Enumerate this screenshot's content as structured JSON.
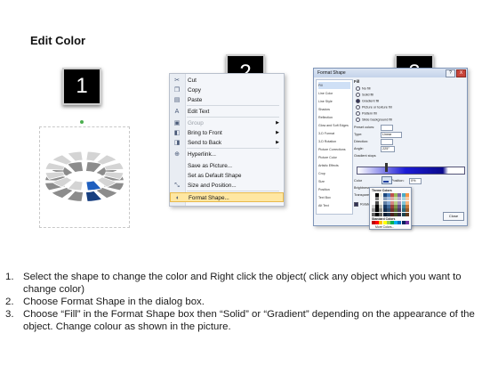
{
  "title": "Edit Color",
  "badges": [
    "1",
    "2",
    "3"
  ],
  "context_menu": {
    "items": [
      {
        "label": "Cut",
        "icon": "scissors-icon",
        "glyph": "✂",
        "disabled": false,
        "arrow": false
      },
      {
        "label": "Copy",
        "icon": "copy-icon",
        "glyph": "❐",
        "disabled": false,
        "arrow": false
      },
      {
        "label": "Paste",
        "icon": "paste-icon",
        "glyph": "▤",
        "disabled": false,
        "arrow": false
      },
      {
        "label": "Edit Text",
        "icon": "edit-text-icon",
        "glyph": "A",
        "disabled": false,
        "arrow": false
      },
      {
        "label": "Group",
        "icon": "group-icon",
        "glyph": "▣",
        "disabled": true,
        "arrow": true
      },
      {
        "label": "Bring to Front",
        "icon": "bring-front-icon",
        "glyph": "◧",
        "disabled": false,
        "arrow": true
      },
      {
        "label": "Send to Back",
        "icon": "send-back-icon",
        "glyph": "◨",
        "disabled": false,
        "arrow": true
      },
      {
        "label": "Hyperlink...",
        "icon": "hyperlink-icon",
        "glyph": "⊕",
        "disabled": false,
        "arrow": false
      },
      {
        "label": "Save as Picture...",
        "icon": "",
        "glyph": "",
        "disabled": false,
        "arrow": false
      },
      {
        "label": "Set as Default Shape",
        "icon": "",
        "glyph": "",
        "disabled": false,
        "arrow": false
      },
      {
        "label": "Size and Position...",
        "icon": "size-position-icon",
        "glyph": "⤡",
        "disabled": false,
        "arrow": false
      },
      {
        "label": "Format Shape...",
        "icon": "format-shape-icon",
        "glyph": "◐",
        "disabled": false,
        "arrow": false
      }
    ]
  },
  "dialog": {
    "title": "Format Shape",
    "help": "?",
    "close": "X",
    "nav": [
      "Fill",
      "Line Color",
      "Line Style",
      "Shadow",
      "Reflection",
      "Glow and Soft Edges",
      "3-D Format",
      "3-D Rotation",
      "Picture Corrections",
      "Picture Color",
      "Artistic Effects",
      "Crop",
      "Size",
      "Position",
      "Text Box",
      "Alt Text"
    ],
    "heading": "Fill",
    "options": [
      "No fill",
      "Solid fill",
      "Gradient fill",
      "Picture or texture fill",
      "Pattern fill",
      "Slide background fill"
    ],
    "fields": {
      "preset": "Preset colors:",
      "type": "Type:",
      "type_value": "Linear",
      "direction": "Direction:",
      "angle": "Angle:",
      "angle_value": "225°",
      "gradient_stops": "Gradient stops",
      "color": "Color",
      "position": "Position:",
      "position_value": "0%",
      "brightness": "Brightness:",
      "transparency": "Transparency:",
      "rotate": "Rotate with shape",
      "close_button": "Close"
    },
    "palette": {
      "theme_label": "Theme Colors",
      "standard_label": "Standard Colors",
      "more_label": "More Colors...",
      "theme_colors": [
        "#ffffff",
        "#000000",
        "#eeece1",
        "#1f497d",
        "#4f81bd",
        "#c0504d",
        "#9bbb59",
        "#8064a2",
        "#4bacc6",
        "#f79646"
      ],
      "standard_colors": [
        "#c00000",
        "#ff0000",
        "#ffc000",
        "#ffff00",
        "#92d050",
        "#00b050",
        "#00b0f0",
        "#0070c0",
        "#002060",
        "#7030a0"
      ]
    }
  },
  "instructions": [
    {
      "num": "1.",
      "text": "Select the shape to change the color and Right click the object( click any object which you want to change color)"
    },
    {
      "num": "2.",
      "text": "Choose Format Shape in the dialog box."
    },
    {
      "num": "3.",
      "text": "Choose “Fill” in the Format Shape box then “Solid” or “Gradient” depending on the appearance of the object. Change colour as shown in the picture."
    }
  ],
  "colors": {
    "selected_segment": "#1f5fbf",
    "ring_segment": "#d4d4d4",
    "menu_highlight": "#ffe7a2"
  }
}
